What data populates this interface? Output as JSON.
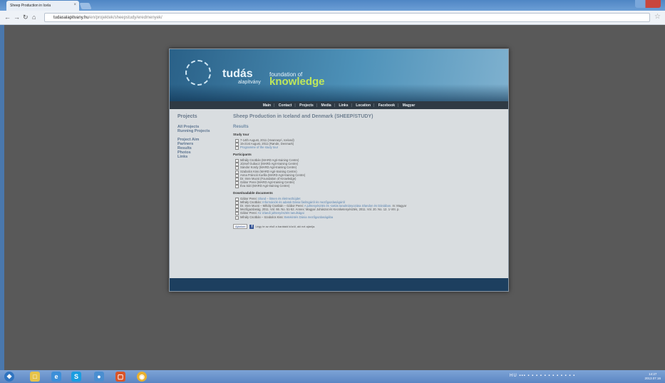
{
  "browser": {
    "tab_title": "Sheep Production in Icela",
    "tab_close": "×",
    "url_host": "tudasalapitvany.hu",
    "url_path": "/en/projektek/sheepstudy/eredmenyek/",
    "back_icon": "arrow-left",
    "forward_icon": "arrow-right",
    "reload_icon": "reload",
    "home_icon": "home",
    "bookmark_icon": "star"
  },
  "site": {
    "logo_tudas": "tudás",
    "logo_alapitvany": "alapítvány",
    "logo_foundation": "foundation of",
    "logo_knowledge": "knowledge",
    "nav": [
      "Main",
      "Contact",
      "Projects",
      "Media",
      "Links",
      "Location",
      "Facebook",
      "Magyar"
    ],
    "nav_separator": "|",
    "sidebar": {
      "heading": "Projects",
      "group1": [
        "All Projects",
        "Running Projects"
      ],
      "group2": [
        "Project Aim",
        "Partners",
        "Results",
        "Photos",
        "Links"
      ]
    },
    "main": {
      "title": "Sheep Production in Iceland and Denmark (SHEEP/STUDY)",
      "results": "Results",
      "study_tour_heading": "Study tour",
      "study_tour": [
        {
          "text": "7-14th August, 2011 (Hvanneyri, Iceland)",
          "link": ""
        },
        {
          "text": "15-21st August, 2011 (Rønde, Denmark)",
          "link": ""
        },
        {
          "text": "",
          "link": "Programme of the study tour"
        }
      ],
      "participants_heading": "Participants",
      "participants": [
        "Mihály Csotbán (MARD Agri-training Centre)",
        "József Gubacz (MARD Agri-training Centre)",
        "Sándor Kordy (MARD Agri-training Centre)",
        "Szabolcs Kiss (MARD Agri-training Centre)",
        "Anna Fránció Kurilla (MARD Agri-training Centre)",
        "Dr. Imre Mucsi (Foundation of Knowledge)",
        "Gábor Perei (MARD Agri-training Centre)",
        "Éva Sári (MARD Agri-training Centre)"
      ],
      "docs_heading": "Downloadable documents",
      "docs": [
        {
          "text": "Gábor Perei:",
          "link": "Izland – litmen és élelmezbújdet"
        },
        {
          "text": "Mihály Csotbán:",
          "link": "Információk és adatok Dánia fásítsgáról és mezőgazdaságáról"
        },
        {
          "text": "Dr. Imre Mucsi – Mihály Csotbán – Gábor Perei:",
          "link": "A juhtenyésztés és -tartás tanulmányozása Izlandon és Dániában.",
          "extra": "In: Magyar"
        },
        {
          "text": "Mezőgazdaság, 2011. Vol. 66. No. 51-52. Annex: Magyar Juhászat és Kecsketenyésztés, 2011. Vol. 20. No. 12. 1-VIII. p.",
          "link": ""
        },
        {
          "text": "Gábor Perei:",
          "link": "Az izlandi juhtenyésztés tanulságai"
        },
        {
          "text": "Mihály Csotbán – Szabolcs Kiss:",
          "link": "Betekintés Dánia mezőgazdaságába"
        }
      ],
      "social_button": "Ajánlom",
      "social_text": "Légy te az első a barátaid közül, aki ezt ajánlja."
    }
  },
  "taskbar": {
    "tray_text": "HU",
    "time": "14:27",
    "date": "2013.07.16"
  }
}
